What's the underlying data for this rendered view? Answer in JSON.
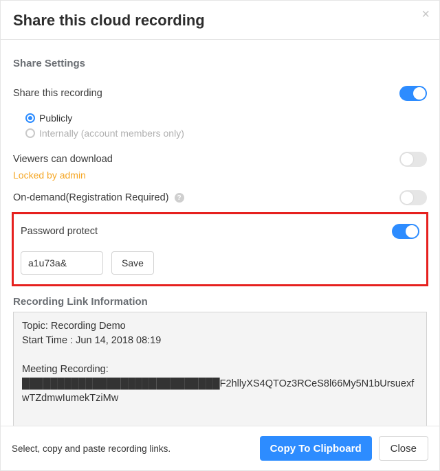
{
  "header": {
    "title": "Share this cloud recording",
    "close_aria": "Close"
  },
  "settings": {
    "section_title": "Share Settings",
    "share_recording": {
      "label": "Share this recording",
      "enabled": true,
      "options": {
        "publicly": "Publicly",
        "internally": "Internally (account members only)",
        "selected": "publicly"
      }
    },
    "viewers_download": {
      "label": "Viewers can download",
      "enabled": false,
      "locked_text": "Locked by admin"
    },
    "on_demand": {
      "label": "On-demand(Registration Required)",
      "enabled": false
    },
    "password_protect": {
      "label": "Password protect",
      "enabled": true,
      "value": "a1u73a&",
      "save_label": "Save"
    }
  },
  "link_info": {
    "title": "Recording Link Information",
    "content": "Topic: Recording Demo\nStart Time : Jun 14, 2018 08:19\n\nMeeting Recording:\n████████████████████████████F2hllyXS4QTOz3RCeS8l66My5N1bUrsuexfwTZdmwIumekTziMw"
  },
  "footer": {
    "hint": "Select, copy and paste recording links.",
    "copy_label": "Copy To Clipboard",
    "close_label": "Close"
  }
}
